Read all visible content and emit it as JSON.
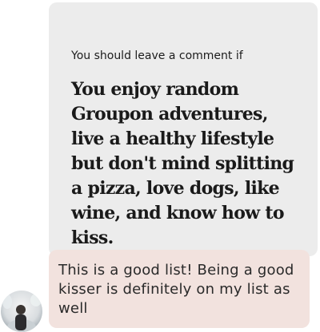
{
  "prompt": {
    "question": "You should leave a comment if",
    "answer": "You enjoy random Groupon adventures, live a healthy lifestyle but don't mind splitting a pizza, love dogs, like wine, and know how to kiss."
  },
  "comment": {
    "text": "This is a good list! Being a good kisser is definitely on my list as well"
  },
  "colors": {
    "card_background": "#ececec",
    "comment_background": "#f2e2de"
  }
}
